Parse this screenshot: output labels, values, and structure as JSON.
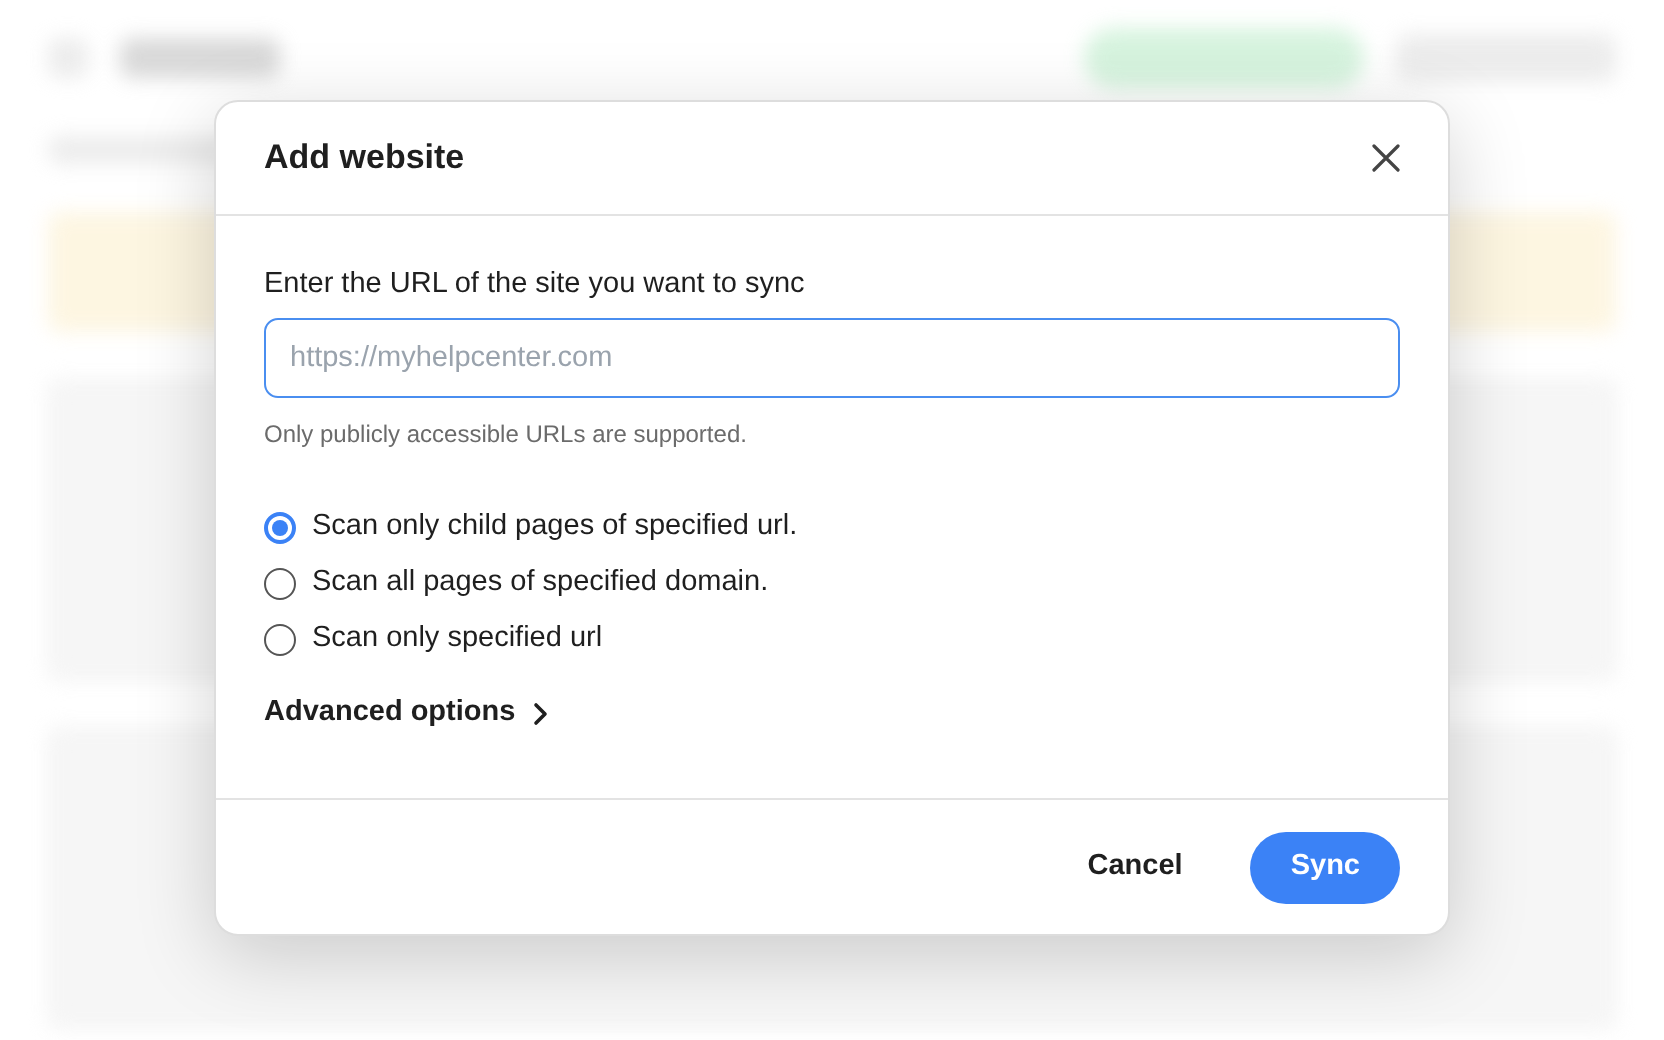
{
  "dialog": {
    "title": "Add website",
    "url_field": {
      "label": "Enter the URL of the site you want to sync",
      "placeholder": "https://myhelpcenter.com",
      "hint": "Only publicly accessible URLs are supported."
    },
    "scan_options": [
      {
        "label": "Scan only child pages of specified url.",
        "selected": true
      },
      {
        "label": "Scan all pages of specified domain.",
        "selected": false
      },
      {
        "label": "Scan only specified url",
        "selected": false
      }
    ],
    "advanced_options": {
      "label": "Advanced options",
      "expanded": false
    },
    "buttons": [
      {
        "label": "Cancel",
        "kind": "secondary"
      },
      {
        "label": "Sync",
        "kind": "primary"
      }
    ]
  }
}
